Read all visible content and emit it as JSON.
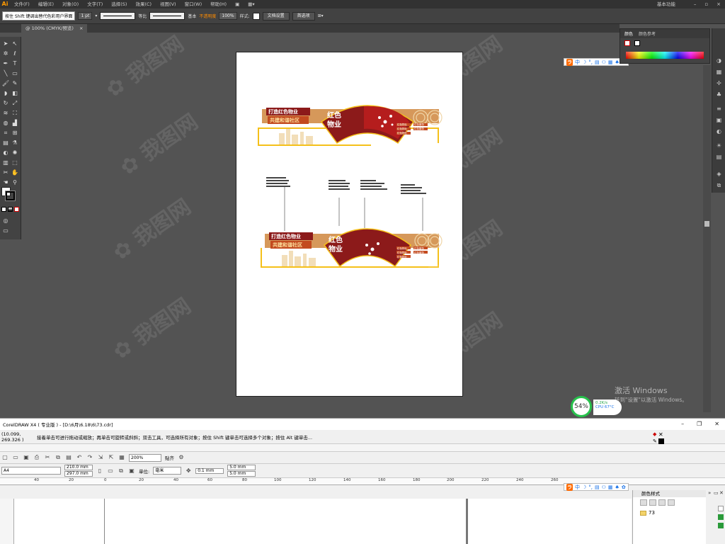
{
  "ai": {
    "logo": "Ai",
    "menus": [
      "文件(F)",
      "编辑(E)",
      "对象(O)",
      "文字(T)",
      "选择(S)",
      "效果(C)",
      "视图(V)",
      "窗口(W)",
      "帮助(H)"
    ],
    "workspace": "基本功能",
    "controlbar": {
      "hint": "按住 Shift 键调出替代色彩用户界面",
      "stroke_weight": "1 pt",
      "profile_label": "等比",
      "brush_label": "基本",
      "opacity_warn": "不透明度",
      "opacity_value": "100%",
      "style_label": "样式:",
      "doc_setup": "文档设置",
      "preferences": "首选项"
    },
    "doc_tab": "@ 100% (CMYK/预览)",
    "doc_tab_close": "×",
    "panel": {
      "tab_color": "颜色",
      "tab_color_ref": "颜色参考"
    }
  },
  "artwork": {
    "slogan_line1": "打造红色物业",
    "slogan_line2": "共建和谐社区",
    "fan_title_1": "红色",
    "fan_title_2": "物业",
    "tags": [
      "红色物业",
      "红色服务",
      "红色物业",
      "红色服务",
      "红色物业"
    ],
    "colors": {
      "gold": "#d6985a",
      "dark_red": "#8c1a1a",
      "red": "#b51d1d",
      "yellow": "#f5c01a"
    }
  },
  "ime": {
    "label": "中"
  },
  "activate_windows": {
    "title": "激活 Windows",
    "subtitle": "转到\"设置\"以激活 Windows。"
  },
  "cpu_widget": {
    "percent": "54%",
    "speed": "0.2K/s",
    "cpu": "CPU 67°C"
  },
  "coreldraw": {
    "title": "CorelDRAW X4 ( 专业版 ) - [D:\\6月\\6.18\\6\\73.cdr]",
    "coords": "(10.099, 269.326 )",
    "status_hint": "接着单击可进行拖动或缩放；再单击可旋转或斜斜；双击工具，可选择所有对象；按住 Shift 键单击可选择多个对象；按住 Alt 键单击...",
    "zoom": "200%",
    "snap": "贴齐",
    "page_size": "A4",
    "width": "210.0 mm",
    "height": "297.0 mm",
    "unit_label": "单位:",
    "unit_value": "毫米",
    "nudge": "0.1 mm",
    "dup_x": "5.0 mm",
    "dup_y": "5.0 mm",
    "ruler_marks": [
      "40",
      "20",
      "0",
      "20",
      "40",
      "60",
      "80",
      "100",
      "120",
      "140",
      "160",
      "180",
      "200",
      "220",
      "240",
      "260"
    ],
    "object_panel_title": "颜色样式",
    "layer_name": "73"
  }
}
